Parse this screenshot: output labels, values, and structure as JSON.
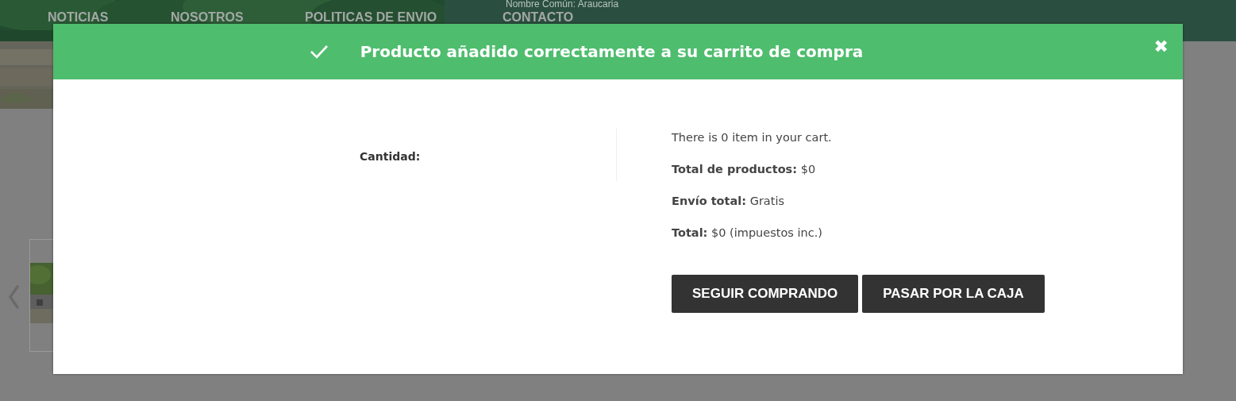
{
  "header": {
    "subtitle": "Nombre Común: Araucaria",
    "nav": [
      {
        "label": "NOTICIAS"
      },
      {
        "label": "NOSOTROS"
      },
      {
        "label": "POLITICAS DE ENVIO"
      },
      {
        "label": "CONTACTO"
      }
    ]
  },
  "modal": {
    "title": "Producto añadido correctamente a su carrito de compra",
    "close": "✖",
    "quantity_label": "Cantidad:",
    "summary": [
      "There is 0 item in your cart.",
      "**Total de productos:** $0",
      "**Envío total:** Gratis",
      "**Total:** $0 (impuestos inc.)"
    ],
    "buttons": [
      {
        "label": "SEGUIR COMPRANDO"
      },
      {
        "label": "PASAR POR LA CAJA"
      }
    ]
  }
}
